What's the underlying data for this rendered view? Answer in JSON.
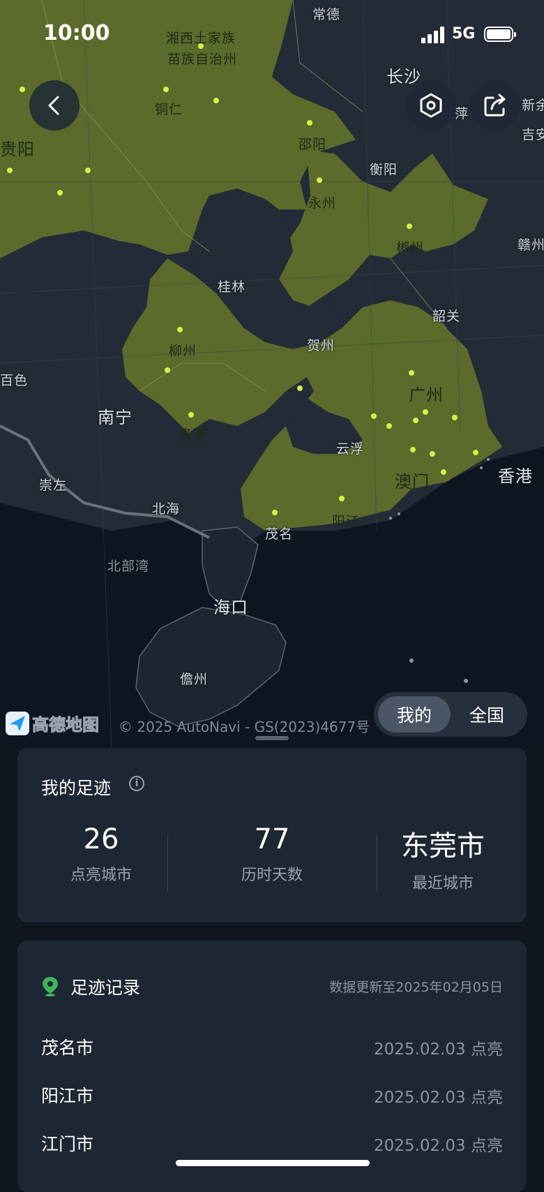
{
  "status_bar": {
    "time": "10:00",
    "network": "5G"
  },
  "map": {
    "labels": {
      "changde": "常德",
      "changsha": "长沙",
      "xiangxi1": "湘西土家族",
      "xiangxi2": "苗族自治州",
      "tongren": "铜仁",
      "shaoyang": "邵阳",
      "hengyang": "衡阳",
      "yongzhou": "永州",
      "guiyang": "贵阳",
      "chenzhou": "郴州",
      "guilin": "桂林",
      "shaoguan": "韶关",
      "hezhou": "贺州",
      "liuzhou": "柳州",
      "baise": "百色",
      "guangzhou": "广州",
      "nanning": "南宁",
      "guigang": "贵港",
      "yunfu": "云浮",
      "chongzuo": "崇左",
      "macau": "澳门",
      "hongkong": "香港",
      "beihai": "北海",
      "yangjiang": "阳江",
      "maoming": "茂名",
      "beibu": "北部湾",
      "haikou": "海口",
      "danzhou": "儋州",
      "xinyu": "新余",
      "jian": "吉安",
      "ganzhou": "赣州",
      "pingxiang": "萍"
    },
    "brand": "高德地图",
    "copyright": "© 2025 AutoNavi - GS(2023)4677号",
    "colors": {
      "visited": "#5a6b2c",
      "unvisited": "#232b36",
      "sea": "#0d1520",
      "dot": "#d4f04a"
    }
  },
  "toggle": {
    "mine": "我的",
    "nation": "全国"
  },
  "footprint": {
    "title": "我的足迹",
    "stats": [
      {
        "value": "26",
        "label": "点亮城市"
      },
      {
        "value": "77",
        "label": "历时天数"
      },
      {
        "value": "东莞市",
        "label": "最近城市"
      }
    ]
  },
  "records": {
    "title": "足迹记录",
    "updated": "数据更新至2025年02月05日",
    "items": [
      {
        "city": "茂名市",
        "date": "2025.02.03 点亮"
      },
      {
        "city": "阳江市",
        "date": "2025.02.03 点亮"
      },
      {
        "city": "江门市",
        "date": "2025.02.03 点亮"
      }
    ]
  }
}
